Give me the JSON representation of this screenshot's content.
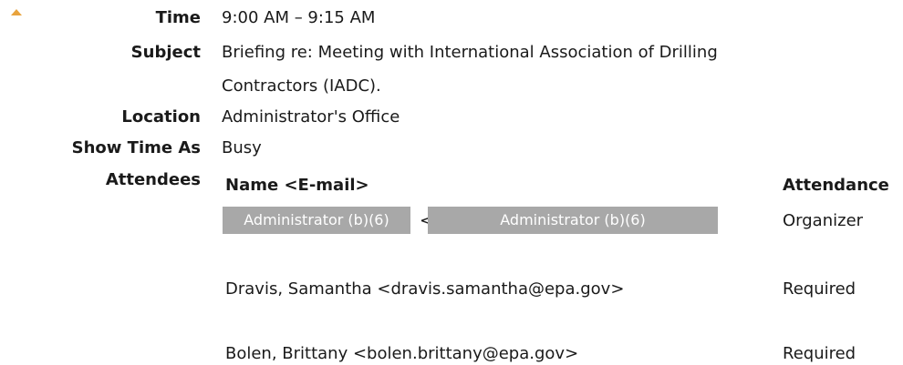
{
  "meeting": {
    "time_label": "Time",
    "time_value": "9:00 AM – 9:15 AM",
    "subject_label": "Subject",
    "subject_line1": "Briefing re: Meeting with International Association of Drilling",
    "subject_line2": "Contractors (IADC).",
    "location_label": "Location",
    "location_value": "Administrator's Office",
    "show_time_as_label": "Show Time As",
    "show_time_as_value": "Busy",
    "attendees_label": "Attendees"
  },
  "attendees": {
    "name_header": "Name <E-mail>",
    "attendance_header": "Attendance",
    "rows": [
      {
        "name_redacted": "Administrator (b)(6)",
        "lt": "<",
        "email_redacted": "Administrator (b)(6)",
        "attendance": "Organizer"
      },
      {
        "name": "Dravis, Samantha <dravis.samantha@epa.gov>",
        "attendance": "Required"
      },
      {
        "name": "Bolen, Brittany <bolen.brittany@epa.gov>",
        "attendance": "Required"
      }
    ]
  },
  "colors": {
    "arrow": "#e8a33d",
    "redaction": "#a8a8a8"
  }
}
